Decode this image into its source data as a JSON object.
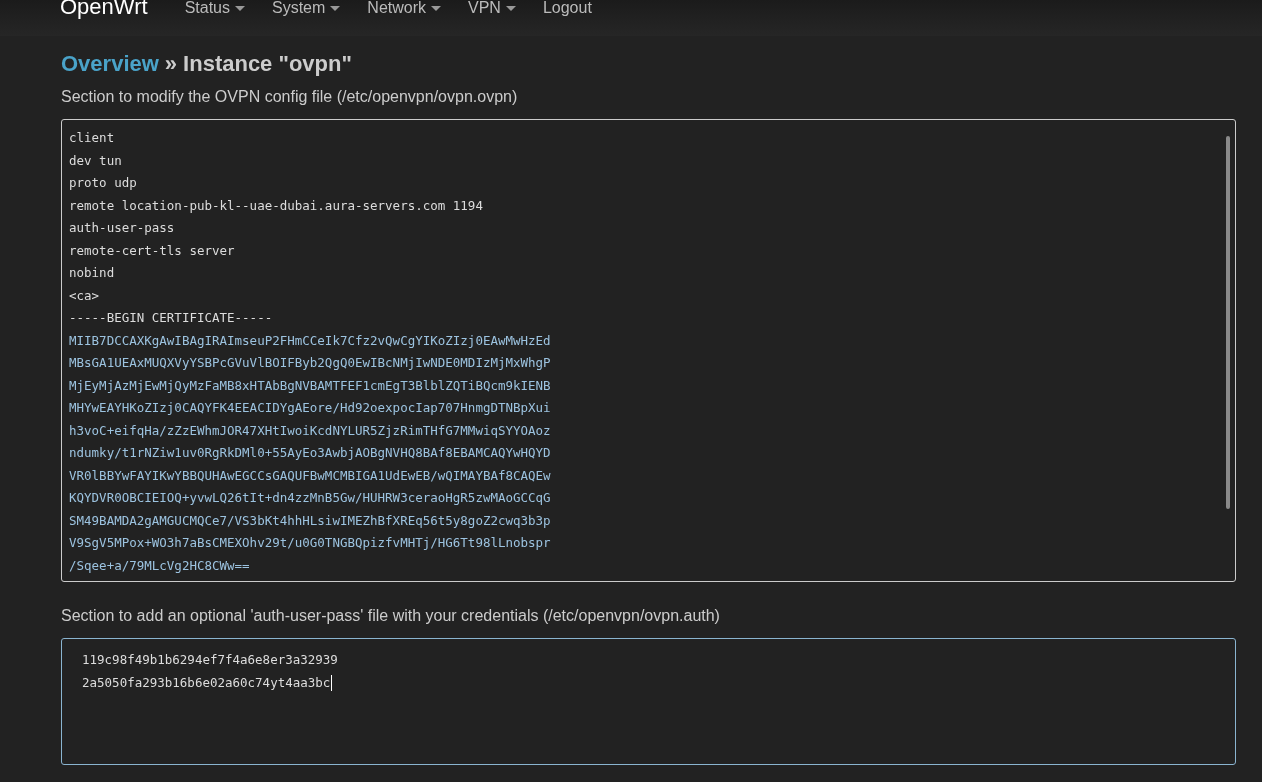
{
  "navbar": {
    "brand": "OpenWrt",
    "menu": [
      {
        "label": "Status",
        "dropdown": true
      },
      {
        "label": "System",
        "dropdown": true
      },
      {
        "label": "Network",
        "dropdown": true
      },
      {
        "label": "VPN",
        "dropdown": true
      },
      {
        "label": "Logout",
        "dropdown": false
      }
    ]
  },
  "breadcrumb": {
    "link": "Overview",
    "separator": "»",
    "current": "Instance \"ovpn\""
  },
  "config_section": {
    "description": "Section to modify the OVPN config file (/etc/openvpn/ovpn.ovpn)",
    "focused": false,
    "lines": [
      {
        "text": "client",
        "kind": "plain"
      },
      {
        "text": "dev tun",
        "kind": "plain"
      },
      {
        "text": "proto udp",
        "kind": "plain"
      },
      {
        "text": "remote location-pub-kl--uae-dubai.aura-servers.com 1194",
        "kind": "plain"
      },
      {
        "text": "auth-user-pass",
        "kind": "plain"
      },
      {
        "text": "remote-cert-tls server",
        "kind": "plain"
      },
      {
        "text": "nobind",
        "kind": "plain"
      },
      {
        "text": "<ca>",
        "kind": "plain"
      },
      {
        "text": "-----BEGIN CERTIFICATE-----",
        "kind": "plain"
      },
      {
        "text": "MIIB7DCCAXKgAwIBAgIRAImseuP2FHmCCeIk7Cfz2vQwCgYIKoZIzj0EAwMwHzEd",
        "kind": "base64"
      },
      {
        "text": "MBsGA1UEAxMUQXVyYSBPcGVuVlBOIFByb2QgQ0EwIBcNMjIwNDE0MDIzMjMxWhgP",
        "kind": "base64"
      },
      {
        "text": "MjEyMjAzMjEwMjQyMzFaMB8xHTAbBgNVBAMTFEF1cmEgT3BlblZQTiBQcm9kIENB",
        "kind": "base64"
      },
      {
        "text": "MHYwEAYHKoZIzj0CAQYFK4EEACIDYgAEore/Hd92oexpocIap707HnmgDTNBpXui",
        "kind": "base64"
      },
      {
        "text": "h3voC+eifqHa/zZzEWhmJOR47XHtIwoiKcdNYLUR5ZjzRimTHfG7MMwiqSYYOAoz",
        "kind": "base64"
      },
      {
        "text": "ndumky/t1rNZiw1uv0RgRkDMl0+55AyEo3AwbjAOBgNVHQ8BAf8EBAMCAQYwHQYD",
        "kind": "base64"
      },
      {
        "text": "VR0lBBYwFAYIKwYBBQUHAwEGCCsGAQUFBwMCMBIGA1UdEwEB/wQIMAYBAf8CAQEw",
        "kind": "base64"
      },
      {
        "text": "KQYDVR0OBCIEIOQ+yvwLQ26tIt+dn4zzMnB5Gw/HUHRW3ceraoHgR5zwMAoGCCqG",
        "kind": "base64"
      },
      {
        "text": "SM49BAMDA2gAMGUCMQCe7/VS3bKt4hhHLsiwIMEZhBfXREq56t5y8goZ2cwq3b3p",
        "kind": "base64"
      },
      {
        "text": "V9SgV5MPox+WO3h7aBsCMEXOhv29t/u0G0TNGBQpizfvMHTj/HG6Tt98lLnobspr",
        "kind": "base64"
      },
      {
        "text": "/Sqee+a/79MLcVg2HC8CWw==",
        "kind": "base64"
      }
    ]
  },
  "auth_section": {
    "description": "Section to add an optional 'auth-user-pass' file with your credentials (/etc/openvpn/ovpn.auth)",
    "focused": true,
    "lines": [
      {
        "text": "119c98f49b1b6294ef7f4a6e8er3a32939",
        "kind": "plain"
      },
      {
        "text": "2a5050fa293b16b6e02a60c74yt4aa3bc",
        "kind": "plain"
      }
    ]
  }
}
